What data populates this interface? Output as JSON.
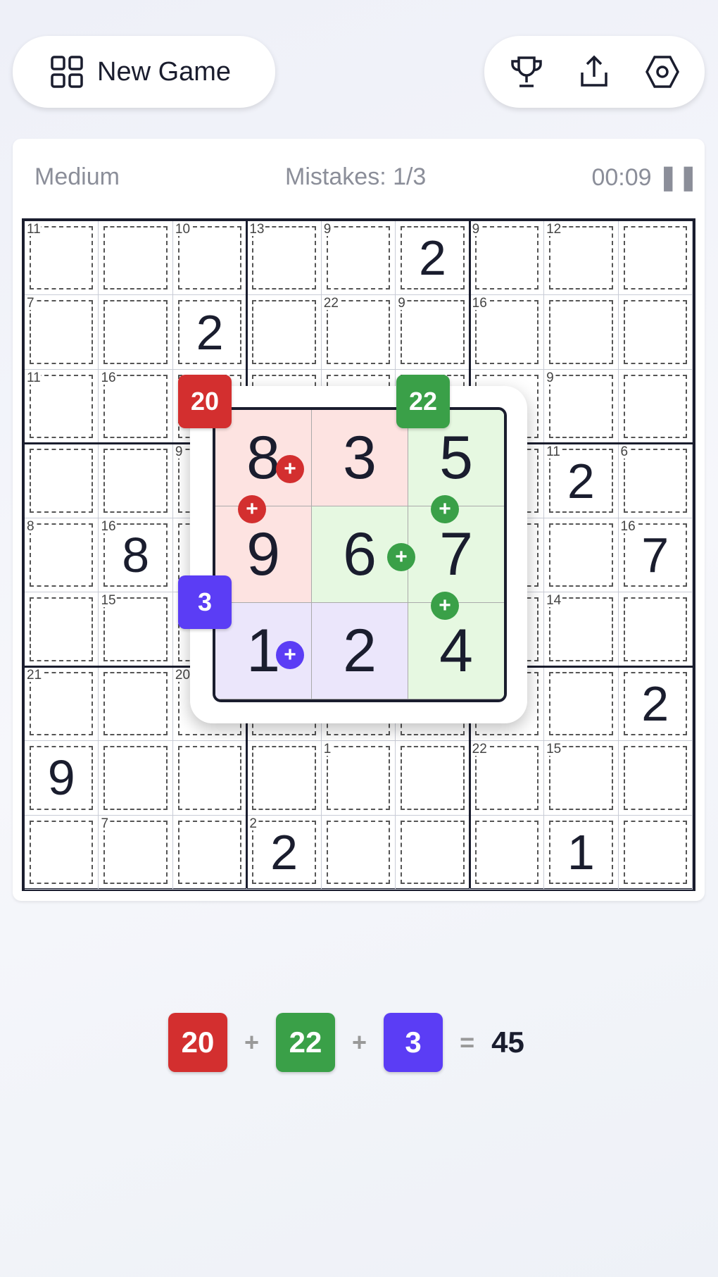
{
  "header": {
    "new_game_label": "New Game",
    "icons": [
      "grid-icon",
      "trophy-icon",
      "share-icon",
      "settings-icon"
    ]
  },
  "status": {
    "difficulty": "Medium",
    "mistakes": "Mistakes: 1/3",
    "timer": "00:09"
  },
  "grid": {
    "givens": [
      [
        0,
        5,
        2
      ],
      [
        1,
        2,
        2
      ],
      [
        3,
        7,
        2
      ],
      [
        4,
        1,
        8
      ],
      [
        4,
        8,
        7
      ],
      [
        6,
        8,
        2
      ],
      [
        7,
        0,
        9
      ],
      [
        8,
        3,
        2
      ],
      [
        8,
        7,
        1
      ]
    ],
    "cage_sums": [
      [
        0,
        0,
        "11"
      ],
      [
        0,
        2,
        "10"
      ],
      [
        0,
        3,
        "13"
      ],
      [
        0,
        4,
        "9"
      ],
      [
        0,
        6,
        "9"
      ],
      [
        0,
        7,
        "12"
      ],
      [
        1,
        0,
        "7"
      ],
      [
        1,
        4,
        "22"
      ],
      [
        1,
        5,
        "9"
      ],
      [
        1,
        6,
        "16"
      ],
      [
        2,
        0,
        "11"
      ],
      [
        2,
        1,
        "16"
      ],
      [
        2,
        7,
        "9"
      ],
      [
        3,
        2,
        "9"
      ],
      [
        3,
        7,
        "11"
      ],
      [
        3,
        8,
        "6"
      ],
      [
        4,
        0,
        "8"
      ],
      [
        4,
        1,
        "16"
      ],
      [
        4,
        8,
        "16"
      ],
      [
        5,
        1,
        "15"
      ],
      [
        5,
        7,
        "14"
      ],
      [
        6,
        0,
        "21"
      ],
      [
        6,
        2,
        "20"
      ],
      [
        7,
        4,
        "1"
      ],
      [
        7,
        6,
        "22"
      ],
      [
        7,
        7,
        "15"
      ],
      [
        8,
        1,
        "7"
      ],
      [
        8,
        3,
        "2"
      ]
    ]
  },
  "popup": {
    "values": [
      [
        "8",
        "3",
        "5"
      ],
      [
        "9",
        "6",
        "7"
      ],
      [
        "1",
        "2",
        "4"
      ]
    ],
    "groups": [
      [
        "red",
        "red",
        "green"
      ],
      [
        "red",
        "green",
        "green"
      ],
      [
        "purple",
        "purple",
        "green"
      ]
    ],
    "badges": [
      {
        "label": "20",
        "color": "#d32f2f"
      },
      {
        "label": "22",
        "color": "#3aa048"
      },
      {
        "label": "3",
        "color": "#5b3df5"
      }
    ]
  },
  "equation": {
    "terms": [
      "20",
      "22",
      "3"
    ],
    "plus": "+",
    "equals": "=",
    "total": "45"
  },
  "colors": {
    "red": "#d32f2f",
    "green": "#3aa048",
    "purple": "#5b3df5",
    "red_bg": "#fde3e1",
    "green_bg": "#e6f8e1",
    "purple_bg": "#ebe6fb"
  }
}
